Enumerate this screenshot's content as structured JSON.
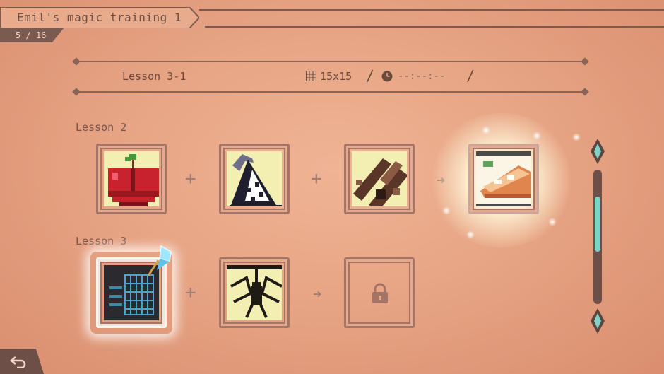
{
  "header": {
    "title": "Emil's magic training 1",
    "counter": "5 / 16"
  },
  "lesson_bar": {
    "label": "Lesson 3-1",
    "grid_size": "15x15",
    "separator": "/",
    "time": "--:--:--"
  },
  "rows": [
    {
      "label": "Lesson 2",
      "tiles": [
        {
          "name": "apple",
          "state": "solved"
        },
        {
          "name": "witch-hat",
          "state": "solved"
        },
        {
          "name": "logs",
          "state": "solved"
        },
        {
          "name": "pie",
          "state": "result-glowing"
        }
      ]
    },
    {
      "label": "Lesson 3",
      "tiles": [
        {
          "name": "grid-sparkle",
          "state": "selected"
        },
        {
          "name": "spider-web",
          "state": "solved"
        },
        {
          "name": "locked",
          "state": "locked"
        }
      ]
    }
  ],
  "colors": {
    "background": "#e7a585",
    "frame": "#a47466",
    "accent_teal": "#7fd3c6",
    "tile_fill": "#f3efb3"
  },
  "icons": {
    "grid": "grid-icon",
    "clock": "clock-icon",
    "lock": "lock-icon",
    "back": "back-arrow-icon"
  }
}
